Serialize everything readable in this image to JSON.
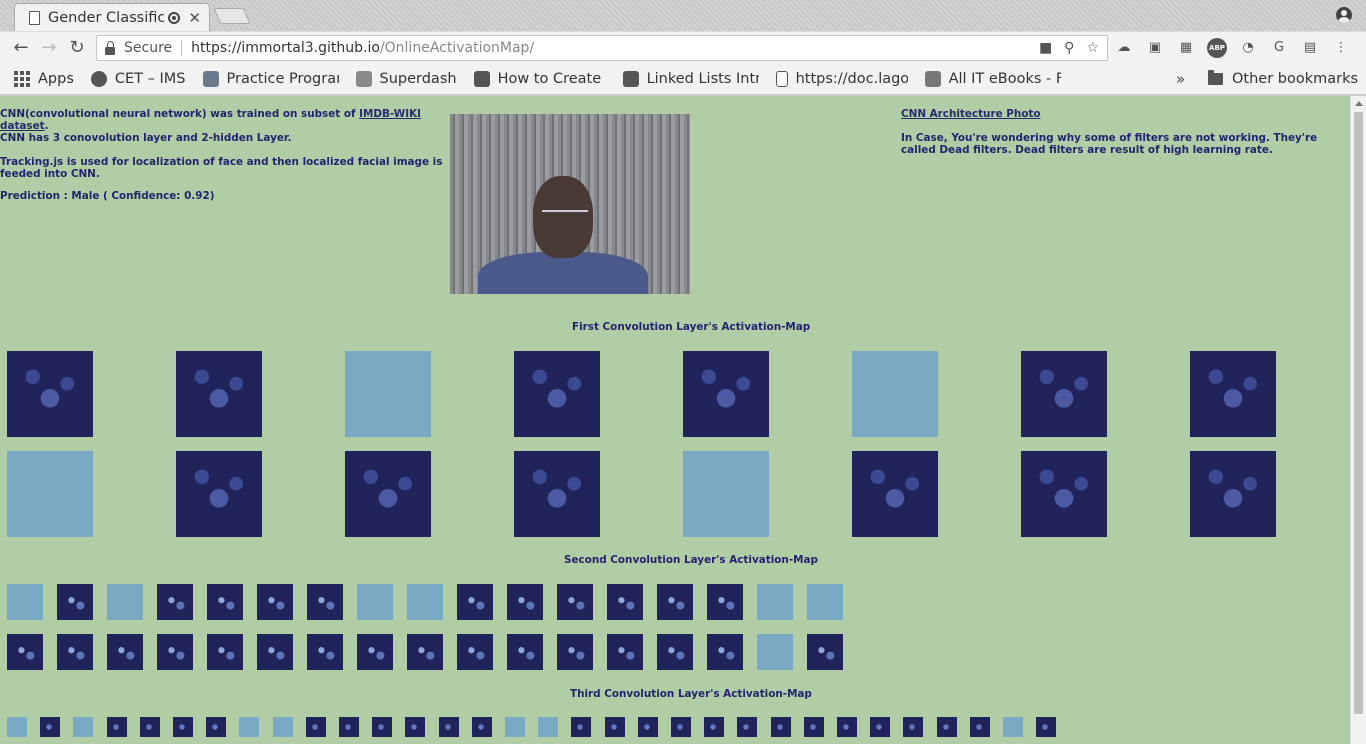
{
  "browser": {
    "tab_title": "Gender Classification",
    "url_scheme_host": "https://immortal3.github.io",
    "url_path": "/OnlineActivationMap/",
    "secure_label": "Secure"
  },
  "bookmarks": {
    "items": [
      "Apps",
      "CET – IMS",
      "Practice Programs",
      "Superdash",
      "How to Create a",
      "Linked Lists Intro",
      "https://doc.lagout",
      "All IT eBooks - Free"
    ],
    "more": "»",
    "other": "Other bookmarks"
  },
  "page": {
    "intro_prefix": "CNN(convolutional neural network) was trained on subset of ",
    "intro_link": "IMDB-WIKI dataset",
    "intro_suffix": ".",
    "layers_text": "CNN has 3 conovolution layer and 2-hidden Layer.",
    "tracking_text": "Tracking.js is used for localization of face and then localized facial image is feeded into CNN.",
    "prediction_text": "Prediction : Male ( Confidence: 0.92)",
    "arch_link": "CNN Architecture Photo ",
    "dead_filters_text": "In Case, You're wondering why some of filters are not working. They're called Dead filters. Dead filters are result of high learning rate.",
    "section1_title": "First Convolution Layer's Activation-Map",
    "section2_title": "Second Convolution Layer's Activation-Map",
    "section3_title": "Third Convolution Layer's Activation-Map"
  },
  "activation_maps": {
    "layer1_dead": [
      false,
      false,
      true,
      false,
      false,
      true,
      false,
      false,
      true,
      false,
      false,
      false,
      true,
      false,
      false,
      false
    ],
    "layer2_dead": [
      true,
      false,
      true,
      false,
      false,
      false,
      false,
      true,
      true,
      false,
      false,
      false,
      false,
      false,
      false,
      true,
      true,
      false,
      false,
      false,
      false,
      false,
      false,
      false,
      false,
      false,
      false,
      false,
      false,
      false,
      false,
      false,
      true,
      false
    ],
    "layer3_dead": [
      true,
      false,
      true,
      false,
      false,
      false,
      false,
      true,
      true,
      false,
      false,
      false,
      false,
      false,
      false,
      true,
      true,
      false,
      false,
      false,
      false,
      false,
      false,
      false,
      false,
      false,
      false,
      false,
      false,
      false,
      true,
      false
    ]
  }
}
